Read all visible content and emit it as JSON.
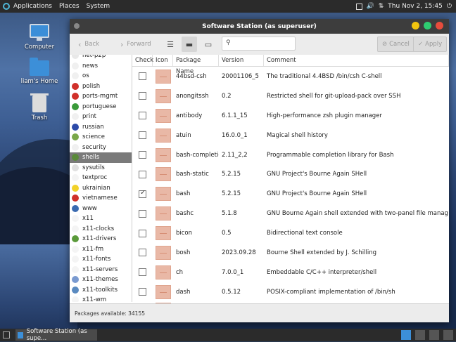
{
  "top_panel": {
    "menus": [
      "Applications",
      "Places",
      "System"
    ],
    "clock": "Thu Nov  2, 15:45"
  },
  "desktop": {
    "icons": [
      {
        "label": "Computer"
      },
      {
        "label": "liam's Home"
      },
      {
        "label": "Trash"
      }
    ]
  },
  "window": {
    "title": "Software Station (as superuser)",
    "toolbar": {
      "back_label": "Back",
      "forward_label": "Forward",
      "search_placeholder": "",
      "cancel_label": "Cancel",
      "apply_label": "Apply"
    },
    "categories": [
      {
        "label": "net-p2p",
        "color": "#e8e8e8"
      },
      {
        "label": "news",
        "color": "#f0f0f0"
      },
      {
        "label": "os",
        "color": "#f0f0f0"
      },
      {
        "label": "polish",
        "color": "#d0302a"
      },
      {
        "label": "ports-mgmt",
        "color": "#d0302a"
      },
      {
        "label": "portuguese",
        "color": "#3a9a3a"
      },
      {
        "label": "print",
        "color": "#f0f0f0"
      },
      {
        "label": "russian",
        "color": "#2c4aa8"
      },
      {
        "label": "science",
        "color": "#7aa84a"
      },
      {
        "label": "security",
        "color": "#f0f0f0"
      },
      {
        "label": "shells",
        "color": "#5a8a3a"
      },
      {
        "label": "sysutils",
        "color": "#e0e0e0"
      },
      {
        "label": "textproc",
        "color": "#f4f4f4"
      },
      {
        "label": "ukrainian",
        "color": "#f2d22a"
      },
      {
        "label": "vietnamese",
        "color": "#d0302a"
      },
      {
        "label": "www",
        "color": "#3a6ab0"
      },
      {
        "label": "x11",
        "color": "#f4f4f4"
      },
      {
        "label": "x11-clocks",
        "color": "#f4f4f4"
      },
      {
        "label": "x11-drivers",
        "color": "#5a9a3a"
      },
      {
        "label": "x11-fm",
        "color": "#f4f4f4"
      },
      {
        "label": "x11-fonts",
        "color": "#f4f4f4"
      },
      {
        "label": "x11-servers",
        "color": "#f4f4f4"
      },
      {
        "label": "x11-themes",
        "color": "#7a9ad0"
      },
      {
        "label": "x11-toolkits",
        "color": "#5a8ac0"
      },
      {
        "label": "x11-wm",
        "color": "#f4f4f4"
      }
    ],
    "selected_category": "shells",
    "columns": {
      "check": "Check",
      "icon": "Icon",
      "name": "Package Name",
      "version": "Version",
      "comment": "Comment"
    },
    "packages": [
      {
        "name": "44bsd-csh",
        "version": "20001106_5",
        "comment": "The traditional 4.4BSD /bin/csh C-shell",
        "checked": false
      },
      {
        "name": "anongitssh",
        "version": "0.2",
        "comment": "Restricted shell for git-upload-pack over SSH",
        "checked": false
      },
      {
        "name": "antibody",
        "version": "6.1.1_15",
        "comment": "High-performance zsh plugin manager",
        "checked": false
      },
      {
        "name": "atuin",
        "version": "16.0.0_1",
        "comment": "Magical shell history",
        "checked": false
      },
      {
        "name": "bash-completion",
        "version": "2.11_2,2",
        "comment": "Programmable completion library for Bash",
        "checked": false
      },
      {
        "name": "bash-static",
        "version": "5.2.15",
        "comment": "GNU Project's Bourne Again SHell",
        "checked": false
      },
      {
        "name": "bash",
        "version": "5.2.15",
        "comment": "GNU Project's Bourne Again SHell",
        "checked": true
      },
      {
        "name": "bashc",
        "version": "5.1.8",
        "comment": "GNU Bourne Again shell extended with two-panel file manag",
        "checked": false
      },
      {
        "name": "bicon",
        "version": "0.5",
        "comment": "Bidirectional text console",
        "checked": false
      },
      {
        "name": "bosh",
        "version": "2023.09.28",
        "comment": "Bourne Shell extended by J. Schilling",
        "checked": false
      },
      {
        "name": "ch",
        "version": "7.0.0_1",
        "comment": "Embeddable C/C++ interpreter/shell",
        "checked": false
      },
      {
        "name": "dash",
        "version": "0.5.12",
        "comment": "POSIX-compliant implementation of /bin/sh",
        "checked": false
      }
    ],
    "status": "Packages available: 34155"
  },
  "taskbar": {
    "task_label": "Software Station (as supe..."
  },
  "colors": {
    "selection": "#7a7a7a",
    "close": "#e74c3c",
    "minimize": "#f1c40f",
    "maximize": "#2ecc71"
  }
}
